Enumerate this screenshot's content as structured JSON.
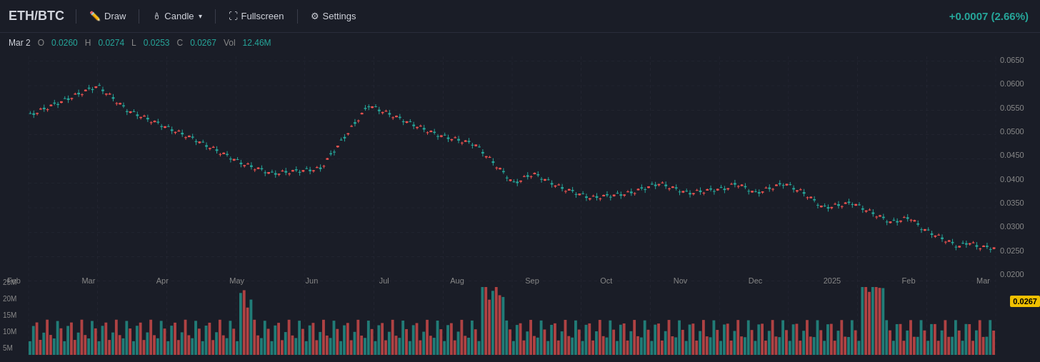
{
  "toolbar": {
    "symbol": "ETH/BTC",
    "draw_label": "Draw",
    "candle_label": "Candle",
    "fullscreen_label": "Fullscreen",
    "settings_label": "Settings",
    "price_change": "+0.0007 (2.66%)"
  },
  "ohlcv": {
    "date": "Mar 2",
    "open_label": "O",
    "open_val": "0.0260",
    "high_label": "H",
    "high_val": "0.0274",
    "low_label": "L",
    "low_val": "0.0253",
    "close_label": "C",
    "close_val": "0.0267",
    "vol_label": "Vol",
    "vol_val": "12.46M"
  },
  "y_axis": {
    "labels": [
      "0.0650",
      "0.0600",
      "0.0550",
      "0.0500",
      "0.0450",
      "0.0400",
      "0.0350",
      "0.0300",
      "0.0250",
      "0.0200"
    ]
  },
  "x_axis": {
    "labels": [
      "Feb",
      "Mar",
      "Apr",
      "May",
      "Jun",
      "Jul",
      "Aug",
      "Sep",
      "Oct",
      "Nov",
      "Dec",
      "2025",
      "Feb",
      "Mar"
    ]
  },
  "vol_axis": {
    "labels": [
      "25M",
      "20M",
      "15M",
      "10M",
      "5M"
    ]
  },
  "current_price": "0.0267",
  "colors": {
    "background": "#1a1d27",
    "up": "#26a69a",
    "down": "#ef5350",
    "grid": "#2a2d3a",
    "text": "#d1d4dc",
    "price_label_bg": "#f0c000"
  }
}
